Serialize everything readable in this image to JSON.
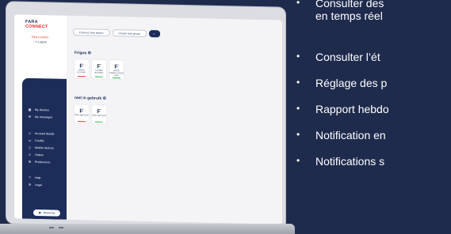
{
  "app": {
    "logo_line1": "FARA",
    "logo_line2": "CONNECT",
    "user_name": "Fara Connect",
    "logout_label": "Logout"
  },
  "sidebar": {
    "items": [
      {
        "label": "My devices",
        "icon": "grid-icon"
      },
      {
        "label": "My messages",
        "icon": "message-icon"
      },
      {
        "label": "Account details",
        "icon": "user-icon"
      },
      {
        "label": "Credits",
        "icon": "card-icon"
      },
      {
        "label": "Mobile devices",
        "icon": "phone-icon"
      },
      {
        "label": "Orders",
        "icon": "list-icon"
      },
      {
        "label": "Preferences",
        "icon": "sliders-icon"
      },
      {
        "label": "Help",
        "icon": "question-icon"
      },
      {
        "label": "Legal",
        "icon": "gear-icon"
      }
    ],
    "webshop_label": "Webshop"
  },
  "toolbar": {
    "connect_label": "Connect new device",
    "create_group_label": "Create new group"
  },
  "groups": [
    {
      "title": "Frigos",
      "devices": [
        {
          "name": "FRIGO RESTANT",
          "status_color": "#e4262b"
        },
        {
          "name": "CUISINE RESTANT",
          "status_color": "#2fb34a"
        },
        {
          "name": "FRIGO CONGELATEUR BAR",
          "status_color": "#2fb34a"
        }
      ]
    },
    {
      "title": "niet in gebruik",
      "devices": [
        {
          "name": "DEM. App Demo",
          "status_color": "#e4262b"
        },
        {
          "name": "DEM. App Demo",
          "status_color": "#2fb34a"
        }
      ]
    }
  ],
  "bullets": [
    {
      "line1": "Consulter des",
      "line2": "en temps réel"
    },
    {
      "line1": "Consulter l’ét"
    },
    {
      "line1": "Réglage des p"
    },
    {
      "line1": "Rapport hebdo"
    },
    {
      "line1": "Notification en"
    },
    {
      "line1": "Notifications s"
    }
  ],
  "colors": {
    "background": "#1f2b4d",
    "navy": "#1c2d5a",
    "accent_red": "#e4262b",
    "status_green": "#2fb34a"
  }
}
